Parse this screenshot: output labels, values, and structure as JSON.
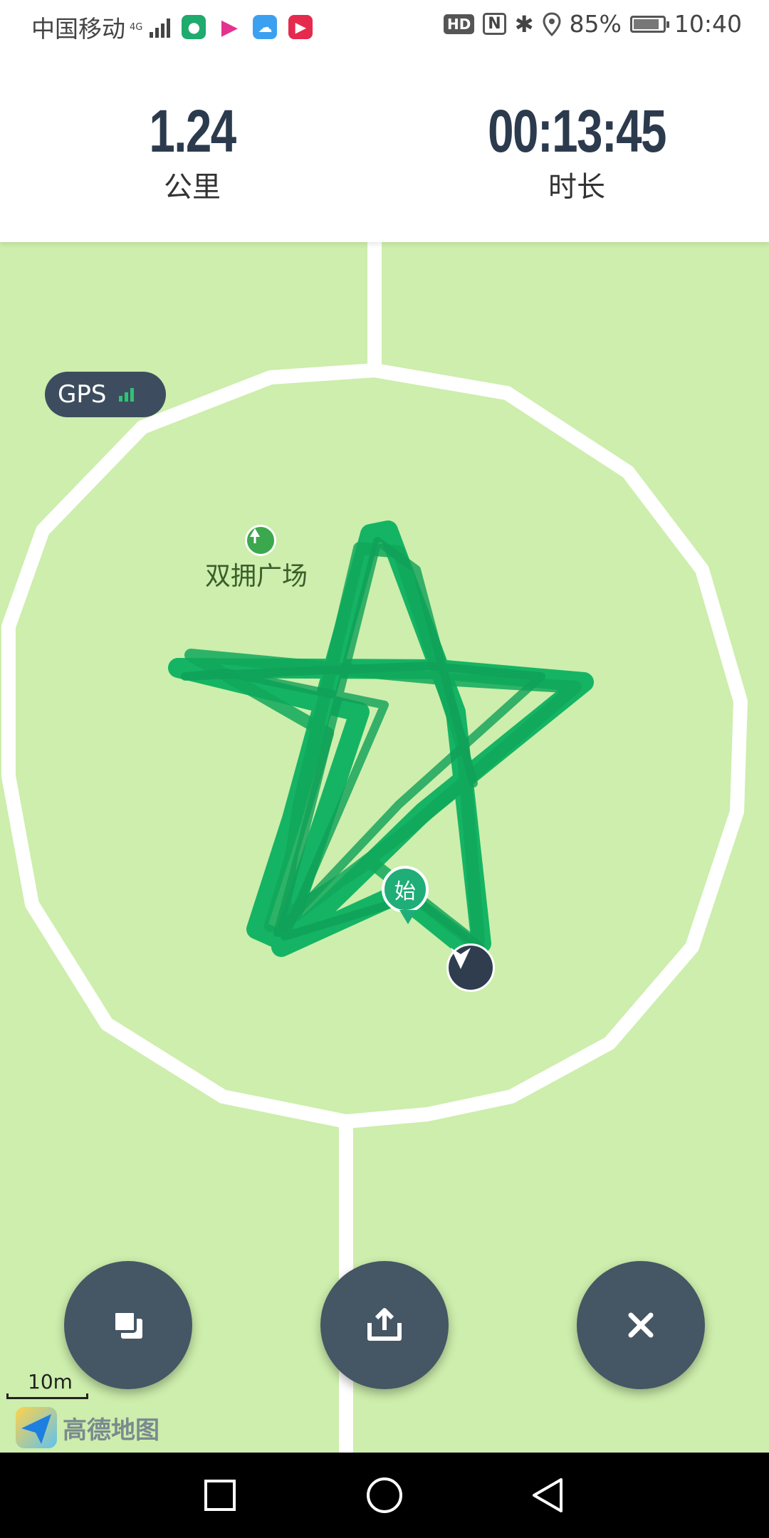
{
  "status_bar": {
    "carrier": "中国移动",
    "network": "4G",
    "battery": "85%",
    "time": "10:40",
    "hd_label": "HD",
    "nfc_label": "N"
  },
  "stats": {
    "distance": {
      "value": "1.24",
      "unit": "公里"
    },
    "duration": {
      "value": "00:13:45",
      "unit": "时长"
    }
  },
  "map": {
    "gps_label": "GPS",
    "poi_name": "双拥广场",
    "start_marker": "始",
    "scale_label": "10m",
    "brand": "高德地图"
  },
  "colors": {
    "track": "#15b464",
    "map_bg": "#cdeeac",
    "road": "#ffffff",
    "fab": "#455665",
    "stat_text": "#2c3a4d"
  },
  "actions": {
    "layers": "layers-icon",
    "share": "share-icon",
    "close": "close-icon"
  },
  "nav": {
    "recent": "recent-apps-icon",
    "home": "home-icon",
    "back": "back-icon"
  }
}
